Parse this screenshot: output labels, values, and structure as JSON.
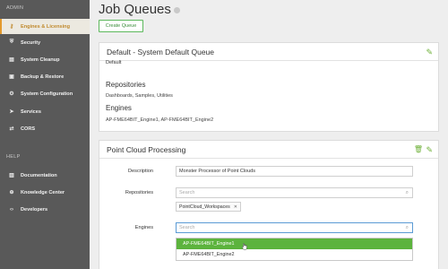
{
  "sidebar": {
    "sections": [
      {
        "label": "ADMIN"
      },
      {
        "label": "HELP"
      }
    ],
    "items": [
      {
        "label": "Engines & Licensing",
        "icon": "key-icon",
        "active": true
      },
      {
        "label": "Security",
        "icon": "shield-icon"
      },
      {
        "label": "System Cleanup",
        "icon": "cleanup-icon"
      },
      {
        "label": "Backup & Restore",
        "icon": "backup-icon"
      },
      {
        "label": "System Configuration",
        "icon": "gear-icon"
      },
      {
        "label": "Services",
        "icon": "paper-plane-icon"
      },
      {
        "label": "CORS",
        "icon": "exchange-icon"
      },
      {
        "label": "Documentation",
        "icon": "book-icon"
      },
      {
        "label": "Knowledge Center",
        "icon": "search-globe-icon"
      },
      {
        "label": "Developers",
        "icon": "code-icon"
      }
    ]
  },
  "page": {
    "title": "Job Queues",
    "create_button": "Create Queue"
  },
  "queue_default": {
    "title": "Default - System Default Queue",
    "subtitle": "Default",
    "repositories_heading": "Repositories",
    "repositories_value": "Dashboards, Samples, Utilities",
    "engines_heading": "Engines",
    "engines_value": "AP-FME64BIT_Engine1, AP-FME64BIT_Engine2"
  },
  "queue_edit": {
    "title": "Point Cloud Processing",
    "description_label": "Description",
    "description_value": "Monster Processor of Point Clouds",
    "repositories_label": "Repositories",
    "repositories_placeholder": "Search",
    "repositories_tag": "PointCloud_Workspaces",
    "engines_label": "Engines",
    "engines_placeholder": "Search",
    "engine_options": [
      {
        "label": "AP-FME64BIT_Engine1",
        "highlighted": true
      },
      {
        "label": "AP-FME64BIT_Engine2",
        "highlighted": false
      }
    ]
  },
  "colors": {
    "sidebar_bg": "#595959",
    "accent_green": "#5cb33d",
    "active_orange": "#e39a2e"
  }
}
